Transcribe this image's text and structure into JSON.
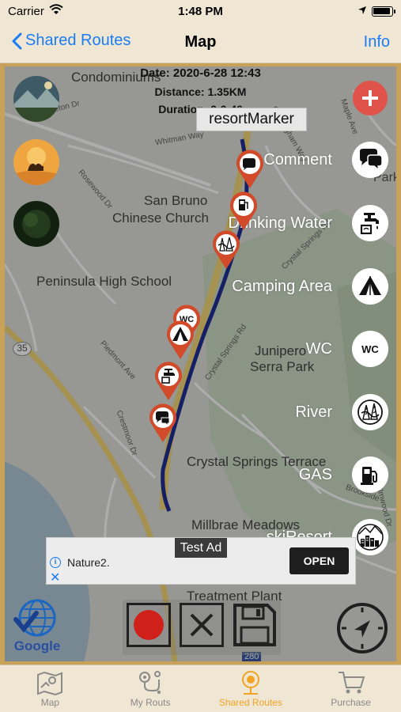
{
  "status_bar": {
    "carrier": "Carrier",
    "time": "1:48 PM"
  },
  "nav": {
    "back_label": "Shared Routes",
    "title": "Map",
    "info_label": "Info"
  },
  "route_info": {
    "date": "Date: 2020-6-28 12:43",
    "distance": "Distance: 1.35KM",
    "duration": "Duration: 0:0:46"
  },
  "resort_marker_label": "resortMarker",
  "poi_menu": [
    {
      "label": "Comment",
      "icon": "comment-icon"
    },
    {
      "label": "Drinking Water",
      "icon": "drinking-water-icon"
    },
    {
      "label": "Camping Area",
      "icon": "tent-icon"
    },
    {
      "label": "WC",
      "icon": "wc-icon"
    },
    {
      "label": "River",
      "icon": "river-icon"
    },
    {
      "label": "GAS",
      "icon": "gas-pump-icon"
    },
    {
      "label": "skiResort",
      "icon": "ski-resort-icon"
    }
  ],
  "wc_text": "WC",
  "map_labels": {
    "condominiums": "Condominiums",
    "san_bruno": "San Bruno",
    "chinese_church": "Chinese Church",
    "peninsula_high": "Peninsula High School",
    "junipero": "Junipero",
    "serra_park": "Serra Park",
    "crystal_terrace": "Crystal Springs Terrace",
    "millbrae": "Millbrae Meadows",
    "treatment": "Treatment Plant",
    "parks": "Parks",
    "hwy_35": "35",
    "hwy_280": "280"
  },
  "streets": {
    "princeton": "Princeton Dr",
    "whitman": "Whitman Way",
    "cunningham": "Cunningham Way",
    "rosewood": "Rosewood Dr",
    "crystal_springs": "Crystal Springs Rd",
    "piedmont": "Piedmont Ave",
    "crestmoor": "Crestmoor Dr",
    "maple": "Maple Ave",
    "brookside": "Brookside",
    "elmwood": "Elmwood Dr"
  },
  "ad": {
    "badge": "Test Ad",
    "title": "Nature2.",
    "open_label": "OPEN"
  },
  "google_text": "Google",
  "tabs": [
    {
      "label": "Map",
      "icon": "map-tab-icon",
      "active": false
    },
    {
      "label": "My Routs",
      "icon": "routes-tab-icon",
      "active": false
    },
    {
      "label": "Shared Routes",
      "icon": "shared-routes-tab-icon",
      "active": true
    },
    {
      "label": "Purchase",
      "icon": "cart-tab-icon",
      "active": false
    }
  ],
  "colors": {
    "accent": "#1a7cf5",
    "active_tab": "#f1a323",
    "route": "#0a1a8c",
    "pin": "#d14a2a",
    "add": "#e0534a"
  }
}
